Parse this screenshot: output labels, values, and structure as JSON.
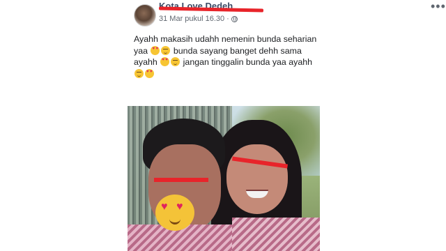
{
  "post": {
    "author_name": "Kota Love Dedeh",
    "timestamp": "31 Mar pukul 16.30",
    "separator": "·",
    "privacy_icon": "globe-icon",
    "more_icon": "more-options-icon",
    "more_symbol": "•••",
    "text_segments": [
      "Ayahh makasih udahh nemenin bunda seharian yaa",
      "bunda sayang banget dehh sama ayahh",
      "jangan tinggalin bunda yaa ayahh"
    ],
    "emoji": [
      "heart-eyes-emoji",
      "smiling-blush-emoji"
    ],
    "photo_alt": "selfie-photo",
    "redaction_color": "#e8242a"
  }
}
